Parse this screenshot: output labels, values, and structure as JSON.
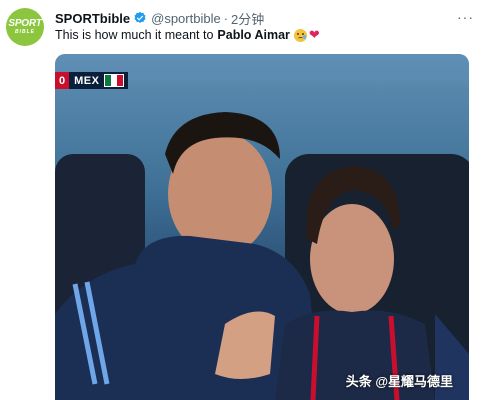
{
  "account": {
    "avatar_text_top": "SPORT",
    "avatar_text_bottom": "BIBLE",
    "name": "SPORTbible",
    "handle": "@sportbible",
    "separator": "·",
    "time": "2分钟",
    "more_icon": "more-icon"
  },
  "tweet": {
    "text_prefix": "This is how much it meant to",
    "text_bold": "Pablo Aimar",
    "emoji_1": "crying-face-icon",
    "emoji_2": "heart-icon"
  },
  "media": {
    "scorebug": {
      "score": "0",
      "team": "MEX",
      "flag": "mexico-flag-icon"
    },
    "watermark": "头条 @星耀马德里"
  },
  "colors": {
    "brand_avatar": "#8cc63f",
    "verified_blue": "#1d9bf0",
    "heart": "#e0245e",
    "secondary_text": "#536471"
  }
}
